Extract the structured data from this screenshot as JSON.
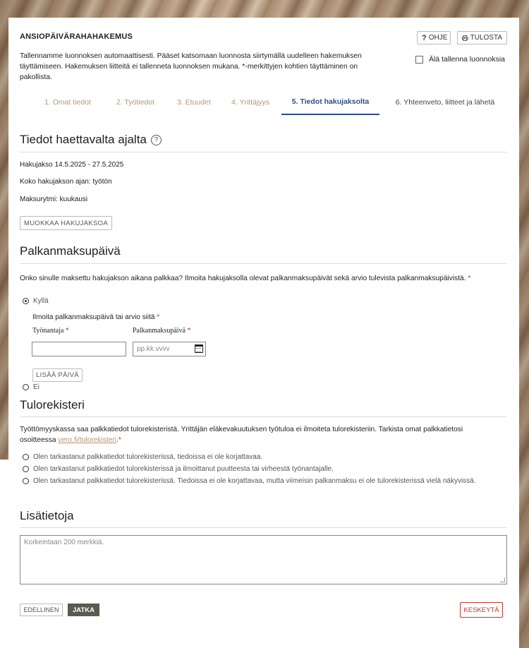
{
  "header": {
    "title": "ANSIOPÄIVÄRAHAHAKEMUS",
    "help_label": "OHJE",
    "help_icon": "?",
    "print_label": "TULOSTA"
  },
  "intro": {
    "text": "Tallennamme luonnoksen automaattisesti. Pääset katsomaan luonnosta siirtymällä uudelleen hakemuksen täyttämiseen. Hakemuksen liitteitä ei tallenneta luonnoksen mukana. *-merkittyjen kohtien täyttäminen on pakollista.",
    "no_save_label": "Älä tallenna luonnoksia"
  },
  "tabs": [
    {
      "label": "1. Omat tiedot"
    },
    {
      "label": "2. Työtiedot"
    },
    {
      "label": "3. Etuudet"
    },
    {
      "label": "4. Yrittäjyys"
    },
    {
      "label": "5. Tiedot hakujaksolta"
    },
    {
      "label": "6. Yhteenveto, liitteet ja lähetä"
    }
  ],
  "active_tab": "5. Tiedot hakujaksolta",
  "period": {
    "heading": "Tiedot haettavalta ajalta",
    "help_icon": "?",
    "range": "Hakujakso 14.5.2025 - 27.5.2025",
    "status": "Koko hakujakson ajan: työtön",
    "payment_rhythm": "Maksurytmi: kuukausi",
    "edit_button": "MUOKKAA HAKUJAKSOA"
  },
  "pay": {
    "heading": "Palkanmaksupäivä",
    "question": "Onko sinulle maksettu hakujakson aikana palkkaa? Ilmoita hakujaksolla olevat palkanmaksupäivät sekä arvio tulevista palkanmaksupäivistä.",
    "required_mark": "*",
    "option_yes": "Kyllä",
    "option_no": "Ei",
    "sub_label": "Ilmoita palkanmaksupäivä tai arvio siitä",
    "employer_label": "Työnantaja",
    "employer_value": "",
    "date_label": "Palkanmaksupäivä",
    "date_placeholder": "pp.kk.vvvv",
    "add_button": "LISÄÄ PÄIVÄ"
  },
  "register": {
    "heading": "Tulorekisteri",
    "text_before": "Työttömyyskassa saa palkkatiedot tulorekisteristä. Yrittäjän eläkevakuutuksen työtuloa ei ilmoiteta tulorekisteriin. Tarkista omat palkkatietosi osoitteessa ",
    "link_text": "vero.fi/tulorekisteri",
    "text_after": ".",
    "required_mark": "*",
    "options": [
      "Olen tarkastanut palkkatiedot tulorekisterissä, tiedoissa ei ole korjattavaa.",
      "Olen tarkastanut palkkatiedot tulorekisterissä ja ilmoittanut puutteesta tai virheestä työnantajalle.",
      "Olen tarkastanut palkkatiedot tulorekisterissä. Tiedoissa ei ole korjattavaa, mutta viimeisin palkanmaksu ei ole tulorekisterissä vielä näkyvissä."
    ]
  },
  "extra": {
    "heading": "Lisätietoja",
    "placeholder": "Korkeintaan 200 merkkiä."
  },
  "footer": {
    "prev": "EDELLINEN",
    "next": "JATKA",
    "cancel": "KESKEYTÄ"
  },
  "colors": {
    "active_tab": "#2b4f8a",
    "inactive_tab": "#b7966f",
    "next_button": "#5a5a50",
    "cancel": "#c0392b"
  }
}
